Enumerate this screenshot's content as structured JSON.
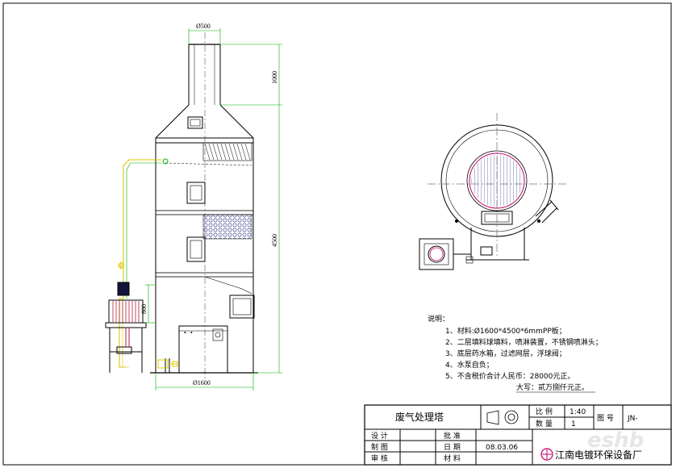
{
  "dimensions": {
    "chimney_dia": "Ø500",
    "chimney_height": "1000",
    "tower_height": "4500",
    "tower_dia": "Ø1600",
    "section_height": "600"
  },
  "notes": {
    "heading": "说明：",
    "lines": [
      "1、材料:Ø1600*4500*6mmPP板；",
      "2、二层填料球填料，喷淋装置，不锈钢喷淋头；",
      "3、底层药水箱，过滤网层，浮球阀；",
      "4、水泵自负；",
      "5、不含税价合计人民币：28000元正。"
    ],
    "price_words": "大写：贰万捌仟元正。"
  },
  "title_block": {
    "drawing_title": "废气处理塔",
    "scale_label": "比 例",
    "scale_value": "1:40",
    "qty_label": "数 量",
    "qty_value": "1",
    "drawing_no_label": "图 号",
    "drawing_no_value": "JN-",
    "design_label": "设 计",
    "drafting_label": "制 图",
    "review_label": "审 核",
    "approve_label": "批 准",
    "date_label": "日 期",
    "date_value": "08.03.06",
    "material_label": "材 料",
    "company": "江南电镀环保设备厂"
  },
  "watermark": "eshb",
  "colors": {
    "outline": "#000000",
    "dimension": "#00b000",
    "pipe": "#d8c800",
    "packing": "#3a3a8a",
    "circle_accent": "#c0006a"
  }
}
